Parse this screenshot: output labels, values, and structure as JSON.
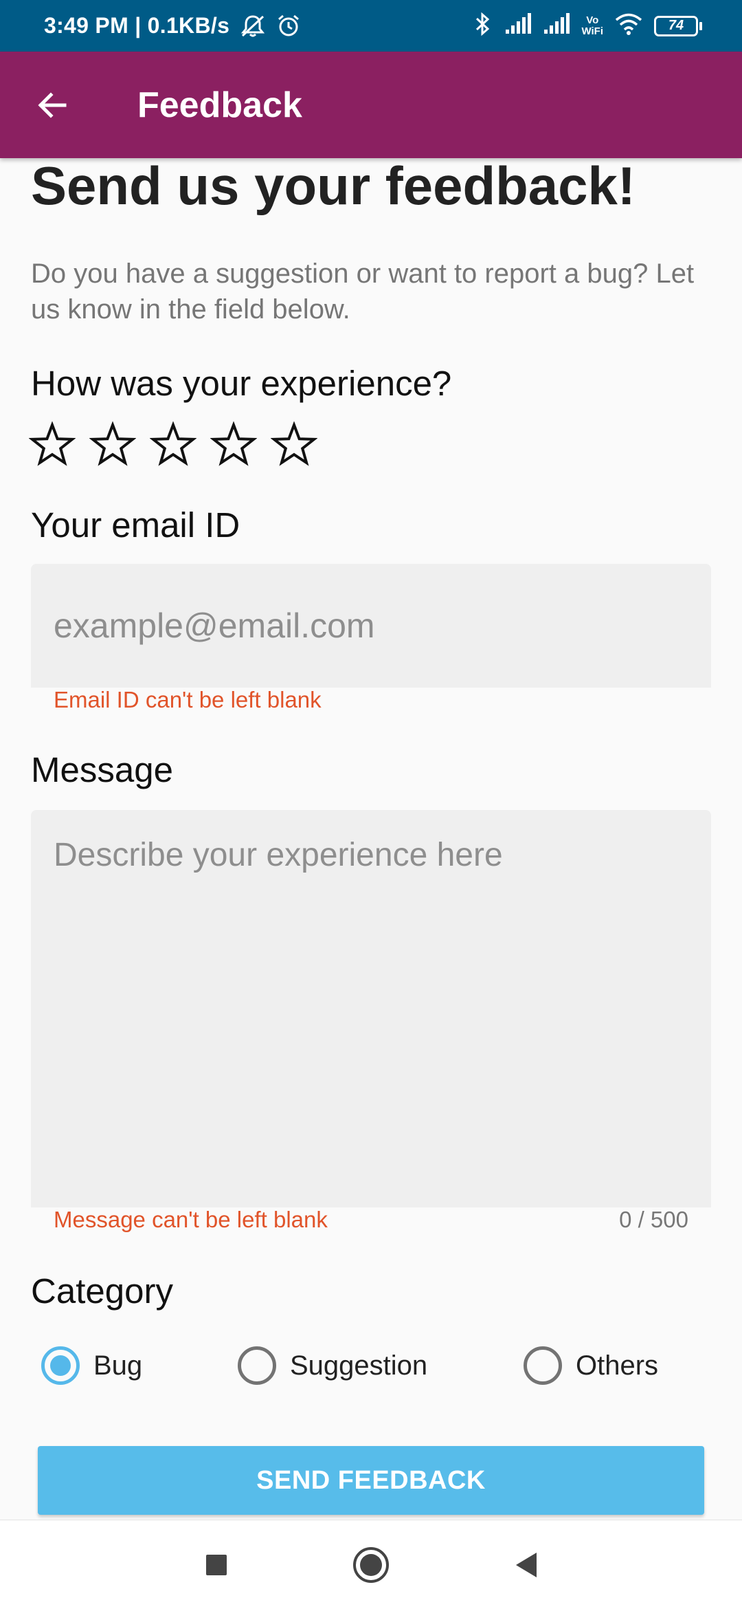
{
  "status_bar": {
    "time_speed": "3:49 PM | 0.1KB/s",
    "wifi_calling": [
      "Vo",
      "WiFi"
    ],
    "battery": "74",
    "icons": [
      "mute-icon",
      "alarm-icon",
      "bluetooth-icon",
      "signal-icon",
      "signal-icon",
      "wifi-icon",
      "battery-icon"
    ]
  },
  "app_bar": {
    "title": "Feedback",
    "back_icon": "arrow-left-icon"
  },
  "content": {
    "headline": "Send us your feedback!",
    "intro": "Do you have a suggestion or want to report a bug? Let us know in the field below.",
    "rating": {
      "label": "How was your experience?",
      "max": 5,
      "value": 0
    },
    "email": {
      "label": "Your email ID",
      "value": "",
      "placeholder": "example@email.com",
      "error": "Email ID can't be left blank"
    },
    "message": {
      "label": "Message",
      "value": "",
      "placeholder": "Describe your experience here",
      "error": "Message can't be left blank",
      "counter": "0 / 500"
    },
    "category": {
      "label": "Category",
      "options": [
        "Bug",
        "Suggestion",
        "Others"
      ],
      "selected": "Bug"
    },
    "submit_label": "SEND FEEDBACK"
  },
  "colors": {
    "status_bar": "#005b87",
    "app_bar": "#8b2061",
    "accent": "#57bcea",
    "error": "#e1542a"
  },
  "nav_bar": {
    "icons": [
      "recents-square-icon",
      "home-circle-icon",
      "back-triangle-icon"
    ]
  }
}
